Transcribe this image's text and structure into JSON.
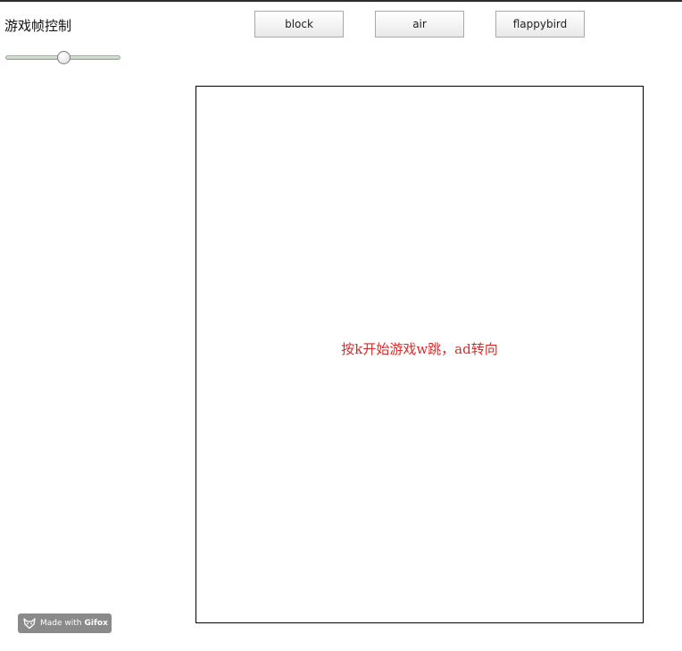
{
  "fps_control": {
    "label": "游戏帧控制",
    "slider_value_fraction": 0.5
  },
  "mode_buttons": [
    {
      "label": "block"
    },
    {
      "label": "air"
    },
    {
      "label": "flappybird"
    }
  ],
  "game": {
    "hint": "按k开始游戏w跳，ad转向"
  },
  "watermark": {
    "prefix": "Made with",
    "brand": "Gifox",
    "icon": "fox-logo-icon"
  },
  "colors": {
    "hint_text": "#d42c2c",
    "canvas_border": "#000000",
    "watermark_bg": "#8a8a8a"
  }
}
